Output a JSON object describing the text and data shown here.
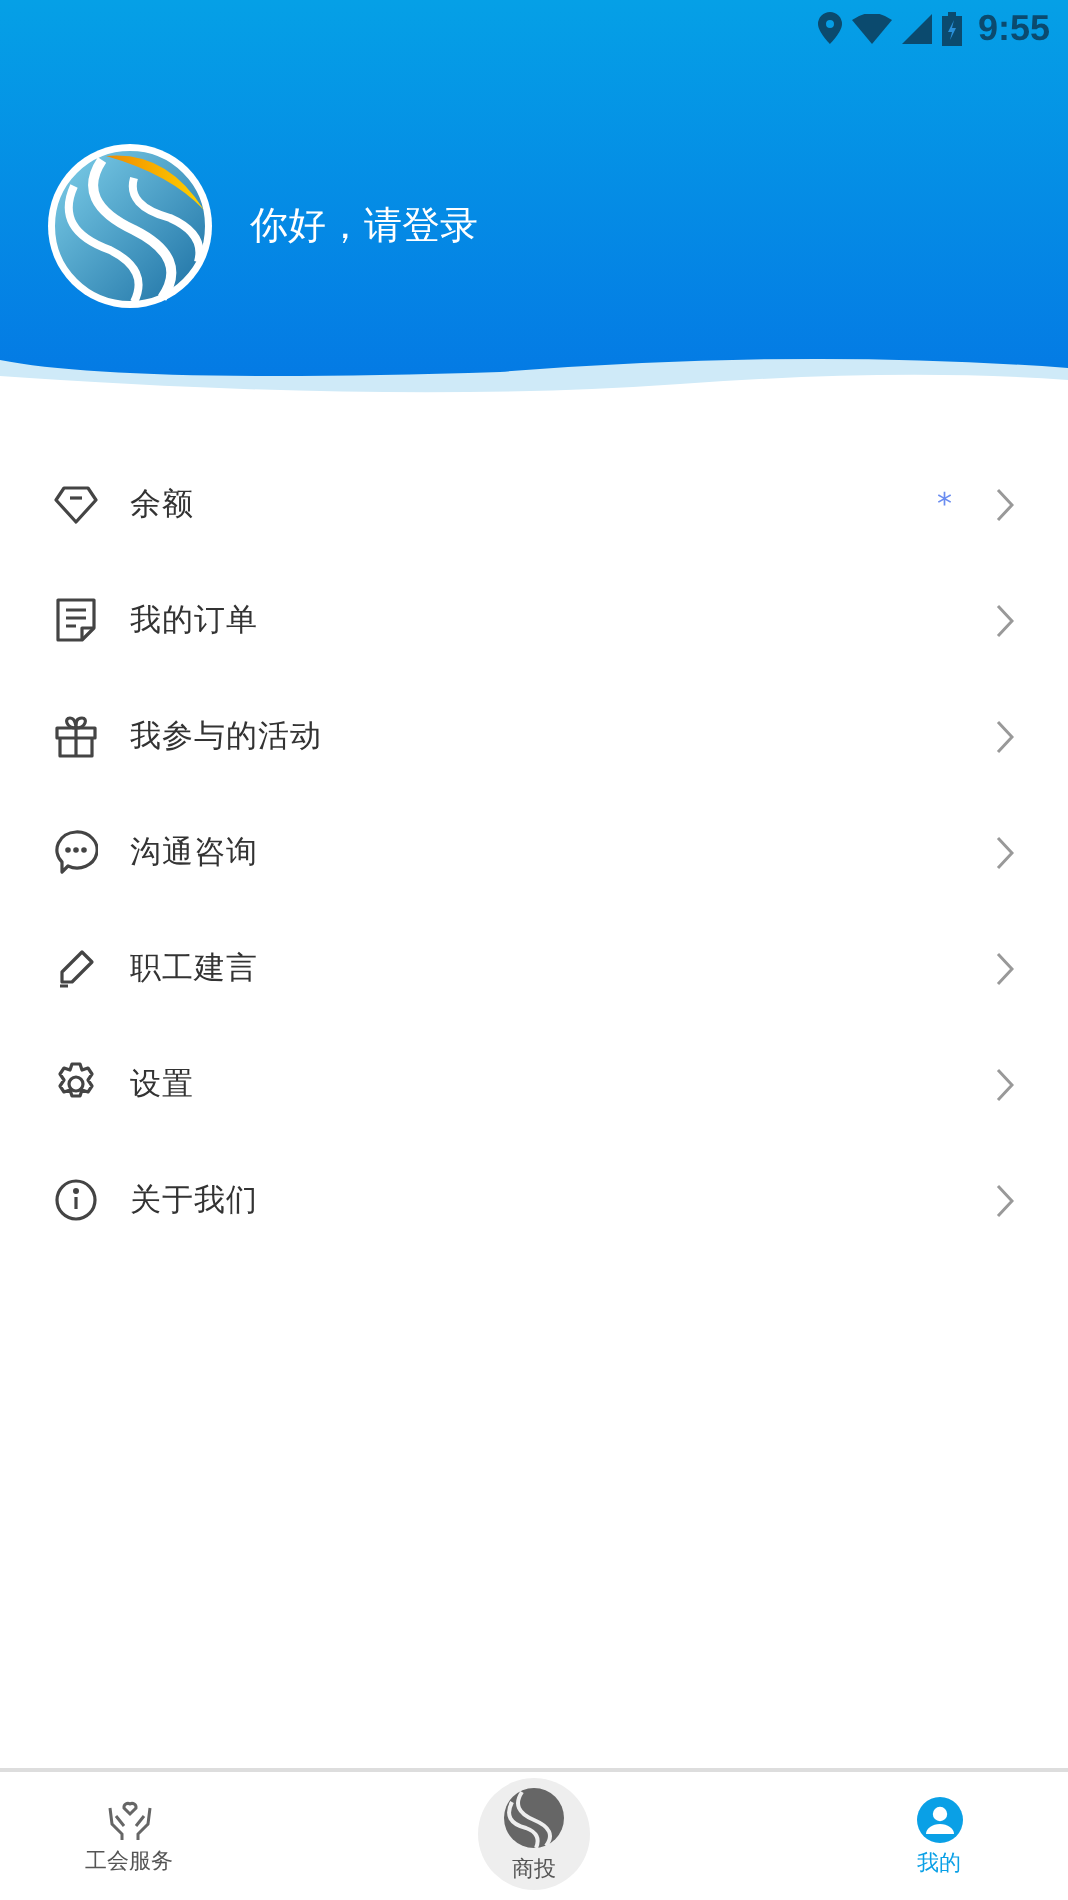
{
  "status_bar": {
    "time": "9:55"
  },
  "header": {
    "greeting": "你好，请登录"
  },
  "menu": [
    {
      "kind": "balance",
      "label": "余额",
      "value": "*"
    },
    {
      "kind": "orders",
      "label": "我的订单"
    },
    {
      "kind": "activities",
      "label": "我参与的活动"
    },
    {
      "kind": "consult",
      "label": "沟通咨询"
    },
    {
      "kind": "suggest",
      "label": "职工建言"
    },
    {
      "kind": "settings",
      "label": "设置"
    },
    {
      "kind": "about",
      "label": "关于我们"
    }
  ],
  "tabs": [
    {
      "kind": "service",
      "label": "工会服务",
      "selected": false
    },
    {
      "kind": "center",
      "label": "商投",
      "selected": false
    },
    {
      "kind": "mine",
      "label": "我的",
      "selected": true
    }
  ]
}
